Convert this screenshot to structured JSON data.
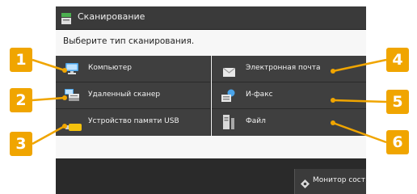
{
  "titlebar": {
    "title": "Сканирование",
    "icon": "scanner-icon"
  },
  "prompt": "Выберите тип сканирования.",
  "buttons": [
    {
      "label": "Компьютер",
      "icon": "computer-icon",
      "callout": "1"
    },
    {
      "label": "Удаленный сканер",
      "icon": "remote-scanner-icon",
      "callout": "2"
    },
    {
      "label": "Устройство памяти USB",
      "icon": "usb-memory-icon",
      "callout": "3"
    },
    {
      "label": "Электронная почта",
      "icon": "envelope-icon",
      "callout": "4"
    },
    {
      "label": "И-факс",
      "icon": "ifax-icon",
      "callout": "5"
    },
    {
      "label": "Файл",
      "icon": "file-server-icon",
      "callout": "6"
    }
  ],
  "status": {
    "monitor_label": "Монитор сост.",
    "icon": "status-monitor-icon"
  },
  "colors": {
    "callout": "#f0a500",
    "button": "#3f3f3f",
    "titlebar": "#3a3a3a",
    "panel": "#f7f7f7"
  }
}
